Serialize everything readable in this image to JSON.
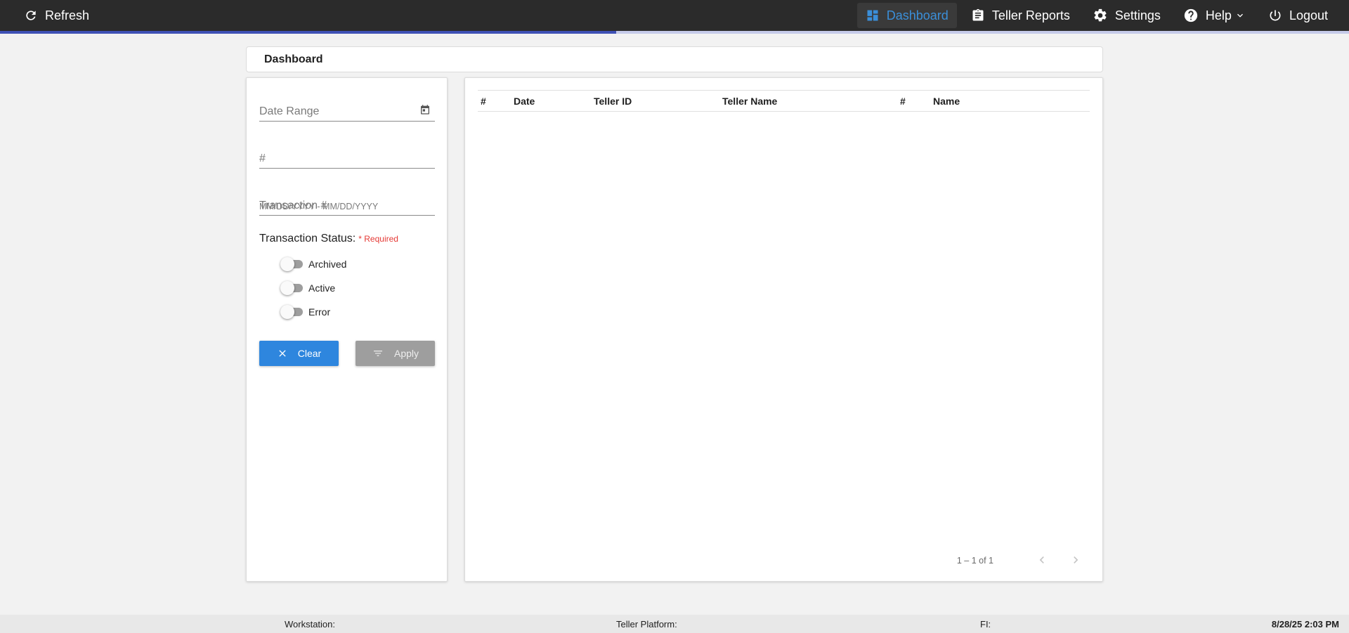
{
  "topbar": {
    "refresh_label": "Refresh",
    "nav": [
      {
        "label": "Dashboard",
        "icon": "dashboard-icon",
        "active": true
      },
      {
        "label": "Teller Reports",
        "icon": "clipboard-icon"
      },
      {
        "label": "Settings",
        "icon": "gear-icon"
      },
      {
        "label": "Help",
        "icon": "help-icon"
      },
      {
        "label": "Logout",
        "icon": "power-icon"
      }
    ],
    "accent_color": "#3b8fd9",
    "progress": 0.457
  },
  "page_title": "Dashboard",
  "filters": {
    "date_range_placeholder": "Date Range",
    "date_range_hint": "MM/DD/YYYY - MM/DD/YYYY",
    "number_placeholder": "#",
    "transaction_placeholder": "Transaction #",
    "status_label": "Transaction Status:",
    "required_label": "* Required",
    "toggles": [
      {
        "label": "Archived",
        "checked": false
      },
      {
        "label": "Active",
        "checked": false
      },
      {
        "label": "Error",
        "checked": false
      }
    ],
    "clear_label": "Clear",
    "apply_label": "Apply"
  },
  "table": {
    "columns": [
      "#",
      "Date",
      "Teller ID",
      "Teller Name",
      "#",
      "Name"
    ],
    "rows": [],
    "pagination": "1 – 1 of 1"
  },
  "footer": {
    "workstation": "Workstation:",
    "teller_platform": "Teller Platform:",
    "fi": "FI:",
    "datetime": "8/28/25 2:03 PM"
  }
}
